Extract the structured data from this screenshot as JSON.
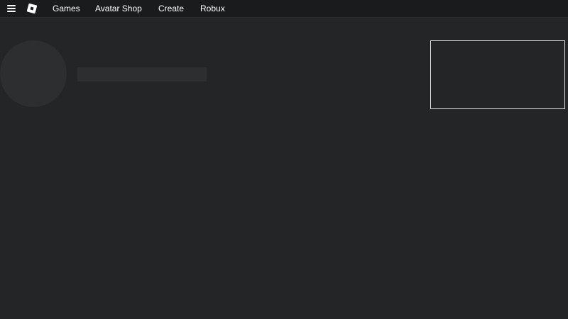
{
  "header": {
    "menu_icon": "hamburger-menu-icon",
    "logo_icon": "roblox-logo-icon",
    "nav": [
      {
        "label": "Games"
      },
      {
        "label": "Avatar Shop"
      },
      {
        "label": "Create"
      },
      {
        "label": "Robux"
      }
    ]
  },
  "colors": {
    "background": "#232527",
    "topbar": "#191b1d",
    "placeholder": "#2c2e30",
    "ad_border": "#e8e8e8",
    "text": "#ffffff"
  }
}
